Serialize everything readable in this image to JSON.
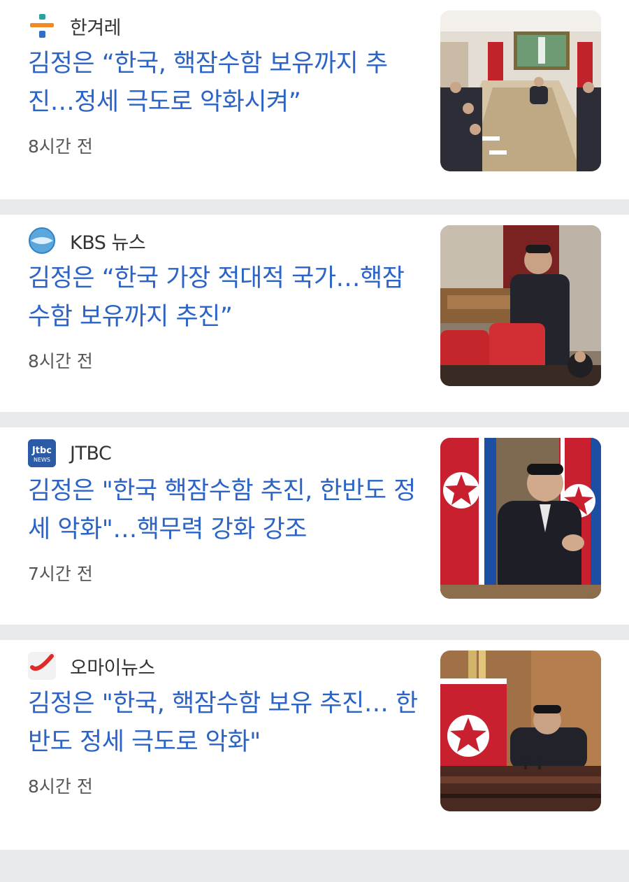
{
  "articles": [
    {
      "source": "한겨레",
      "logo_icon": "hani-logo-icon",
      "headline": "김정은 “한국, 핵잠수함 보유까지 추진…정세 극도로 악화시켜”",
      "time": "8시간 전",
      "thumbnail": "meeting-table-thumbnail"
    },
    {
      "source": "KBS 뉴스",
      "logo_icon": "kbs-logo-icon",
      "headline": "김정은 “한국 가장 적대적 국가…핵잠수함 보유까지 추진”",
      "time": "8시간 전",
      "thumbnail": "podium-speech-thumbnail"
    },
    {
      "source": "JTBC",
      "logo_icon": "jtbc-logo-icon",
      "headline": "김정은 \"한국 핵잠수함 추진, 한반도 정세 악화\"…핵무력 강화 강조",
      "time": "7시간 전",
      "thumbnail": "flags-clapping-thumbnail"
    },
    {
      "source": "오마이뉴스",
      "logo_icon": "ohmynews-logo-icon",
      "headline": "김정은 \"한국, 핵잠수함 보유 추진… 한반도 정세 극도로 악화\"",
      "time": "8시간 전",
      "thumbnail": "podium-flag-thumbnail"
    }
  ],
  "colors": {
    "headline": "#2b63c6",
    "separator": "#e9eaee",
    "flag_red": "#c8202f",
    "flag_blue": "#1c4fa3"
  }
}
